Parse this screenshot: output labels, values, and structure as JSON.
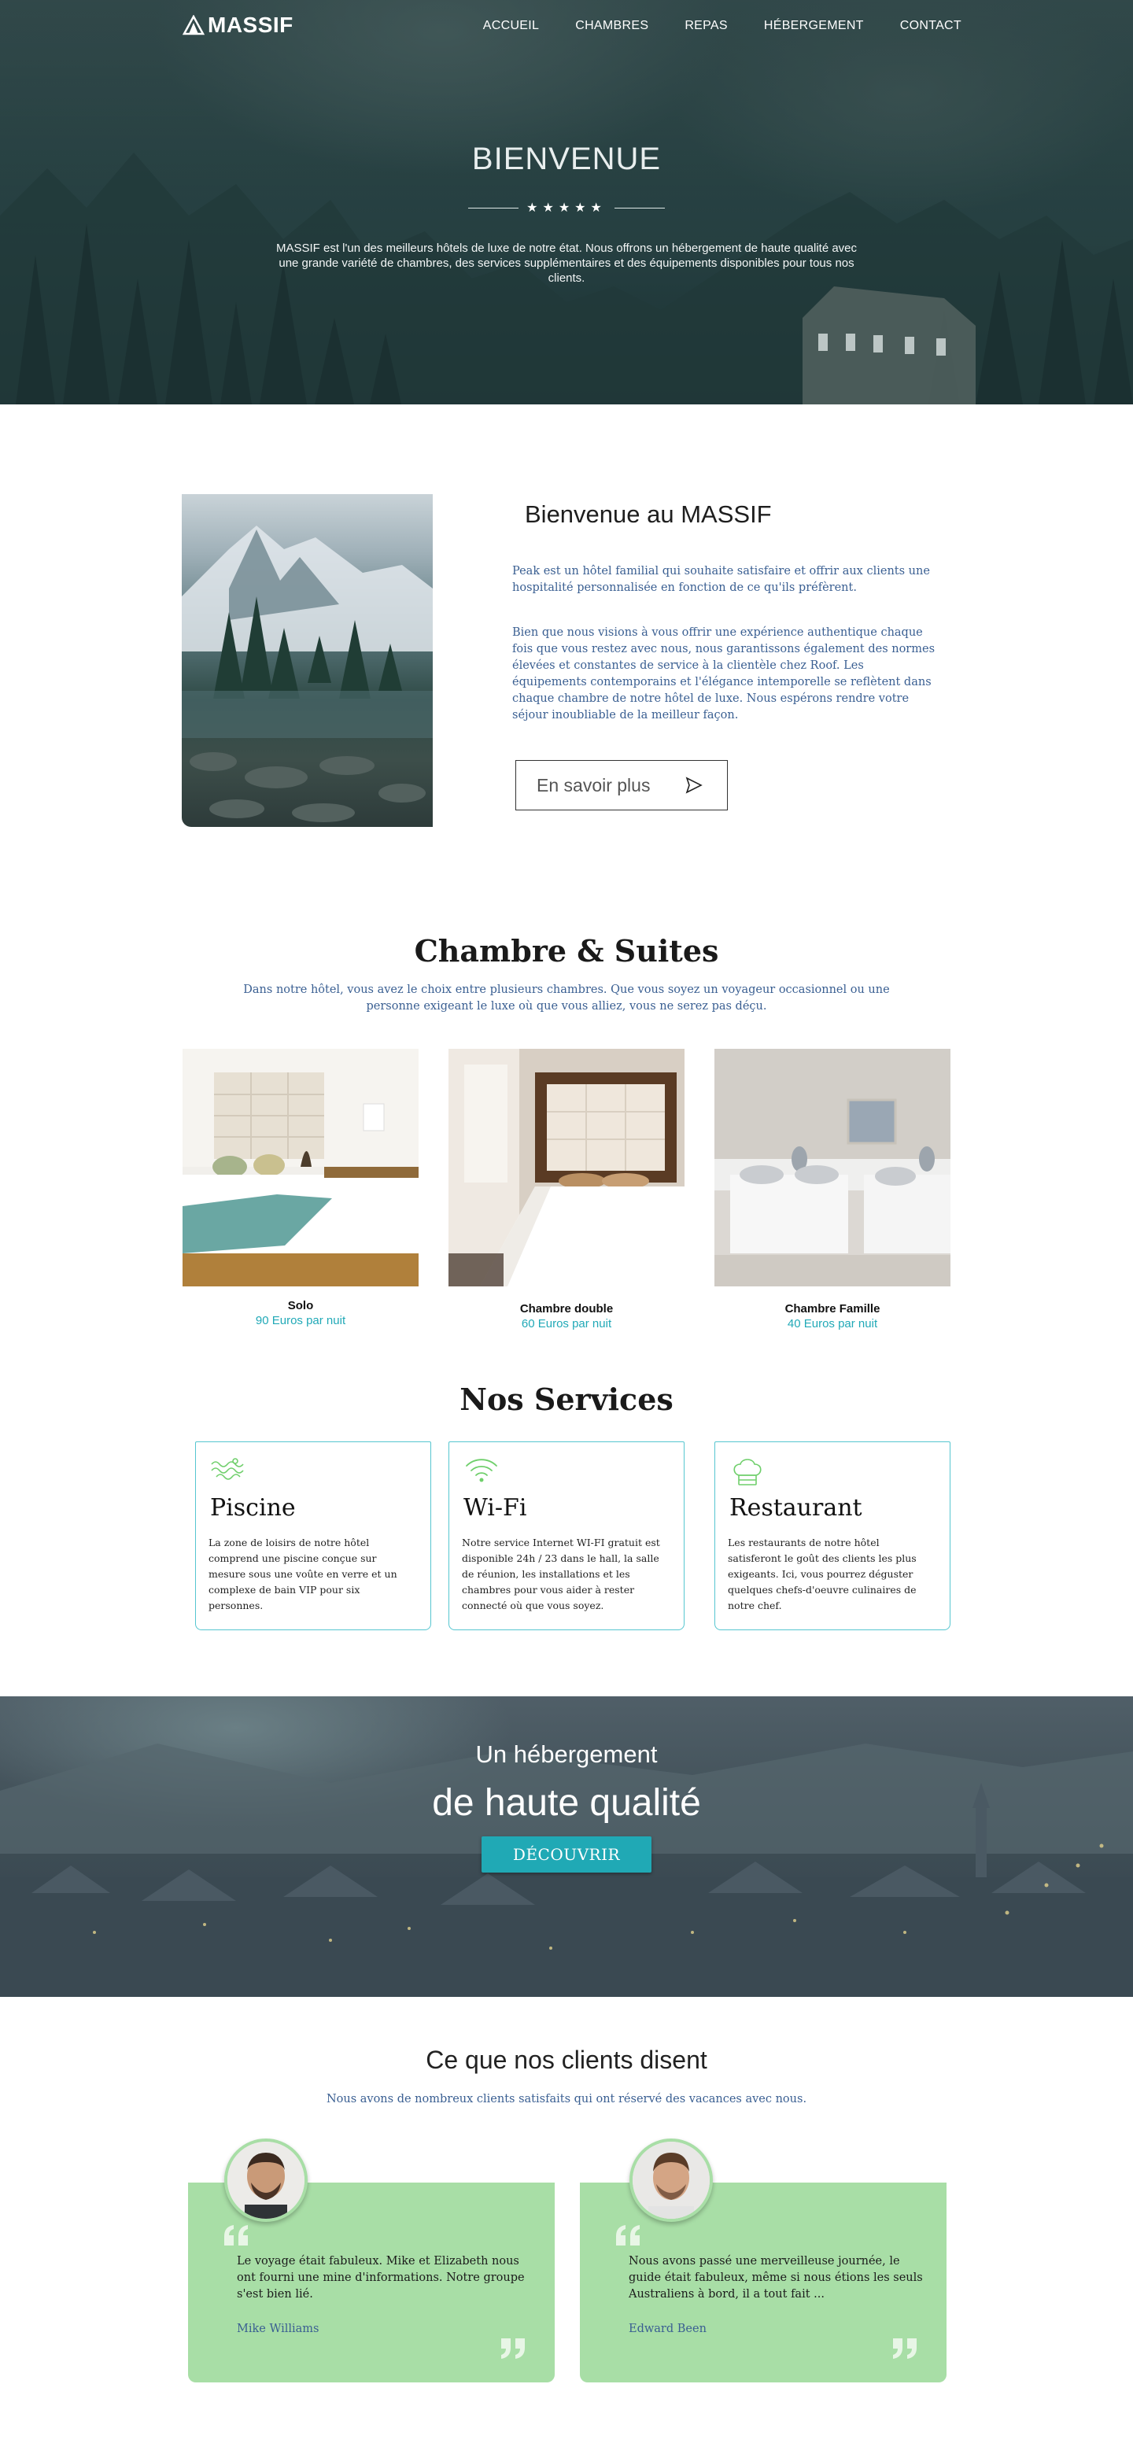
{
  "nav": {
    "logo": "MASSIF",
    "links": [
      "ACCUEIL",
      "CHAMBRES",
      "REPAS",
      "HÉBERGEMENT",
      "CONTACT"
    ]
  },
  "hero": {
    "title": "BIENVENUE",
    "stars": "★★★★★",
    "description": "MASSIF est l'un des meilleurs hôtels de luxe de notre état. Nous offrons un hébergement de haute qualité avec une grande variété de chambres, des services supplémentaires et des équipements disponibles pour tous nos clients."
  },
  "about": {
    "title": "Bienvenue au MASSIF",
    "paragraph1": "Peak est un hôtel familial qui souhaite satisfaire et offrir aux clients une hospitalité personnalisée en fonction de ce qu'ils préfèrent.",
    "paragraph2": "Bien que nous visions à vous offrir une expérience authentique chaque fois que vous restez avec nous, nous garantissons également des normes élevées et constantes de service à la clientèle chez Roof. Les équipements contemporains et l'élégance intemporelle se reflètent dans chaque chambre de notre hôtel de luxe. Nous espérons rendre votre séjour inoubliable de la meilleur façon.",
    "button": "En savoir plus"
  },
  "rooms": {
    "title": "Chambre & Suites",
    "description": "Dans notre hôtel, vous avez le choix entre plusieurs chambres. Que vous soyez un voyageur occasionnel ou une personne exigeant le luxe où que vous alliez, vous ne serez pas déçu.",
    "items": [
      {
        "name": "Solo",
        "price": "90 Euros par nuit"
      },
      {
        "name": "Chambre double",
        "price": "60 Euros par nuit"
      },
      {
        "name": "Chambre Famille",
        "price": "40 Euros par nuit"
      }
    ]
  },
  "services": {
    "title": "Nos Services",
    "items": [
      {
        "icon": "pool-icon",
        "title": "Piscine",
        "text": "La zone de loisirs de notre hôtel comprend une piscine conçue sur mesure sous une voûte en verre et un complexe de bain VIP pour six personnes."
      },
      {
        "icon": "wifi-icon",
        "title": "Wi-Fi",
        "text": "Notre service Internet WI-FI gratuit est disponible 24h / 23 dans le hall, la salle de réunion, les installations et les chambres pour vous aider à rester connecté où que vous soyez."
      },
      {
        "icon": "chef-hat-icon",
        "title": "Restaurant",
        "text": "Les restaurants de notre hôtel satisferont le goût des clients les plus exigeants. Ici, vous pourrez déguster quelques chefs-d'oeuvre culinaires de notre chef."
      }
    ]
  },
  "banner": {
    "subtitle": "Un hébergement",
    "title": "de haute qualité",
    "button": "DÉCOUVRIR"
  },
  "testimonials": {
    "title": "Ce que nos clients disent",
    "description": "Nous avons de nombreux clients satisfaits qui ont réservé des vacances avec nous.",
    "items": [
      {
        "text": "Le voyage était fabuleux. Mike et Elizabeth nous ont fourni une mine d'informations. Notre groupe s'est bien lié.",
        "name": "Mike Williams"
      },
      {
        "text": "Nous avons passé une merveilleuse journée, le guide était fabuleux, même si nous étions les seuls Australiens à bord, il a tout fait ...",
        "name": "Edward Been"
      }
    ]
  },
  "colors": {
    "accent": "#21a9b7",
    "text_blue": "#3a5f92",
    "testimonial_bg": "#a8dea6",
    "service_border": "#56c6d0"
  }
}
